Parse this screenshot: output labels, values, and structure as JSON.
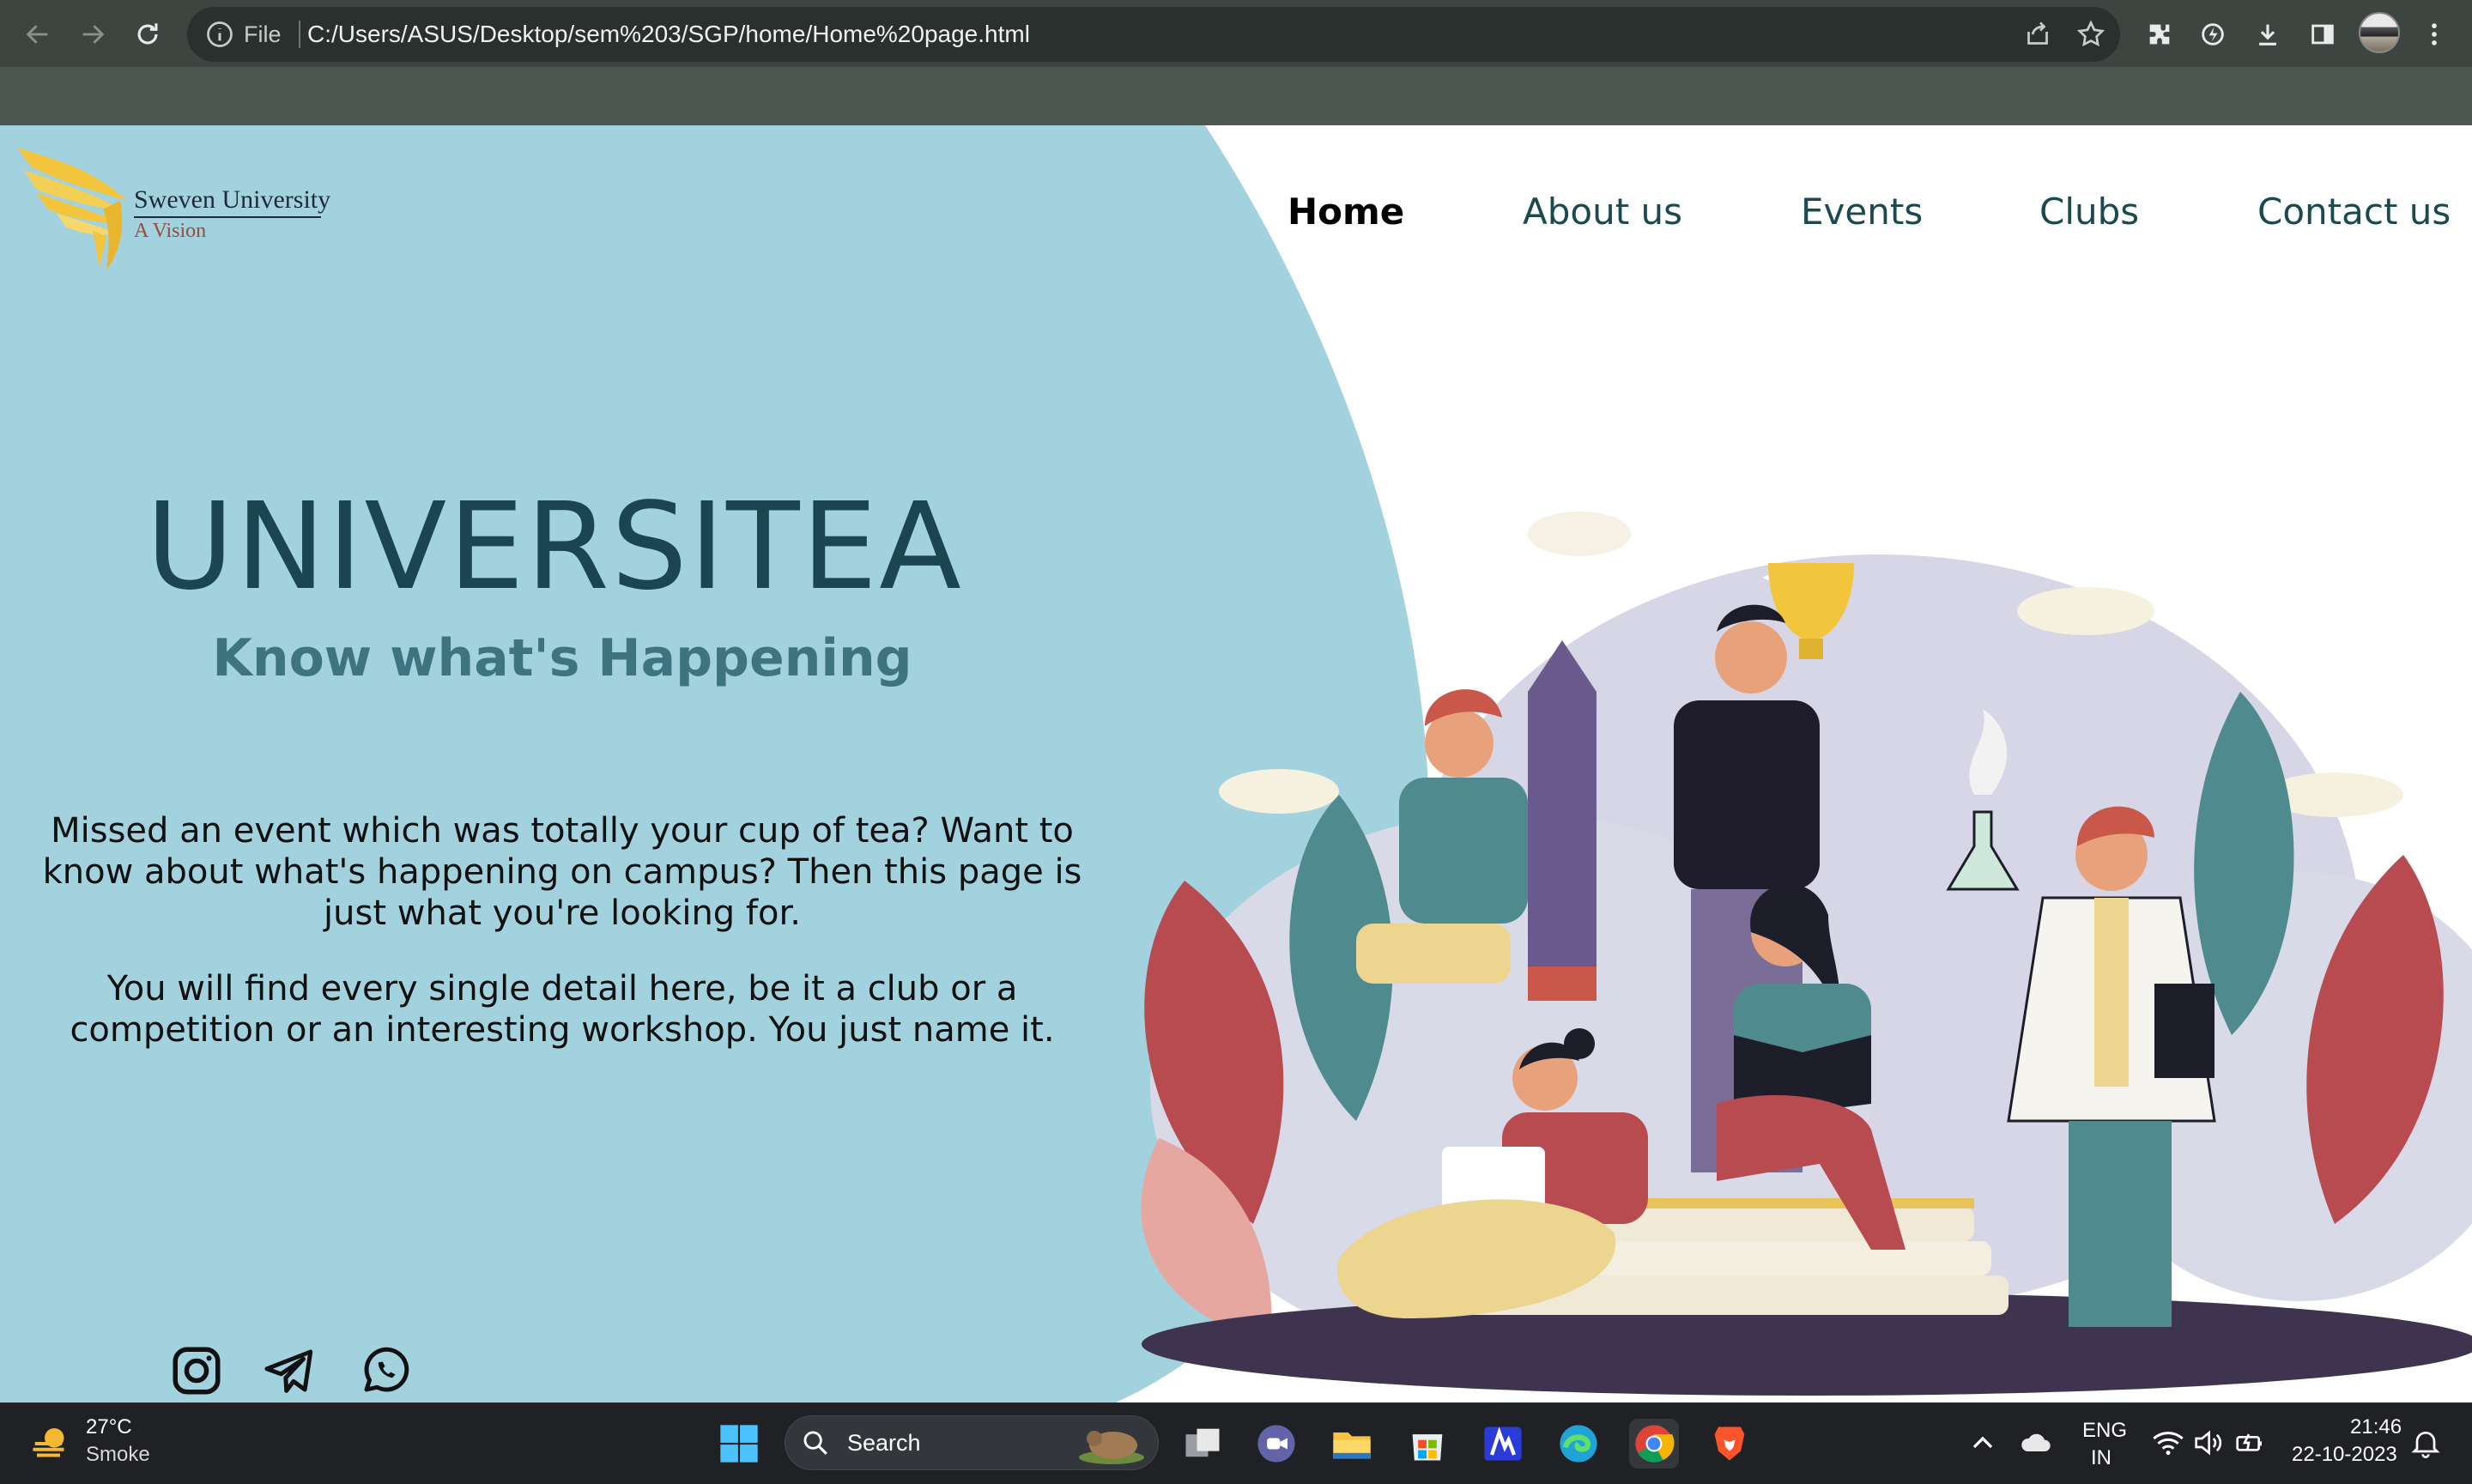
{
  "browser": {
    "scheme_label": "File",
    "url": "C:/Users/ASUS/Desktop/sem%203/SGP/home/Home%20page.html"
  },
  "site": {
    "logo_title": "Sweven University",
    "logo_subtitle": "A Vision",
    "nav": [
      {
        "label": "Home",
        "active": true
      },
      {
        "label": "About us"
      },
      {
        "label": "Events"
      },
      {
        "label": "Clubs"
      },
      {
        "label": "Contact us"
      }
    ],
    "hero_title": "UNIVERSITEA",
    "hero_subtitle": "Know what's Happening",
    "paragraph1": "Missed an event which was totally your cup of tea? Want to know about what's happening on campus? Then this page is just what you're looking for.",
    "paragraph2": "You will find every single detail here, be it a club or a competition or an interesting workshop. You just name it.",
    "social_icons": [
      "instagram-icon",
      "telegram-icon",
      "whatsapp-icon"
    ],
    "colors": {
      "panel": "#a2d2de",
      "title": "#1b4550",
      "subtitle": "#3d7480",
      "logo_wing": "#f2c53d"
    }
  },
  "taskbar": {
    "weather_temp": "27°C",
    "weather_desc": "Smoke",
    "search_placeholder": "Search",
    "lang_line1": "ENG",
    "lang_line2": "IN",
    "time": "21:46",
    "date": "22-10-2023"
  }
}
